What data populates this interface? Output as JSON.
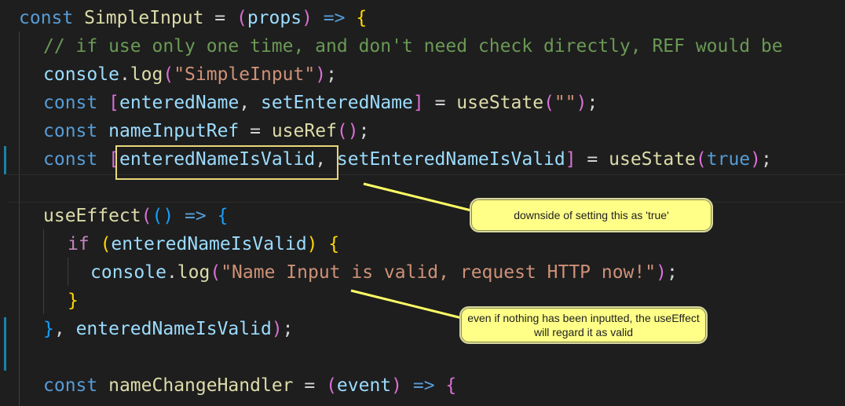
{
  "editor": {
    "theme_colors": {
      "background": "#1e1e1e",
      "keyword": "#569cd6",
      "function": "#dcdcaa",
      "variable": "#9cdcfe",
      "string": "#ce9178",
      "comment": "#6a9955",
      "bracket_level1": "#ffd700",
      "bracket_level2": "#da70d6",
      "bracket_level3": "#179fff",
      "gutter_change_marker": "#1b81a8",
      "annotation_box": "#e8d77c",
      "callout_fill": "#ffff88"
    },
    "lines": {
      "l1": {
        "kw": "const",
        "name": "SimpleInput",
        "eq": " = ",
        "paren_open": "(",
        "param": "props",
        "paren_close": ")",
        "arrow": " => ",
        "brace": "{"
      },
      "l2": {
        "comment": "// if use only one time, and don't need check directly, REF would be"
      },
      "l3": {
        "obj": "console",
        "dot": ".",
        "method": "log",
        "paren_open": "(",
        "string": "\"SimpleInput\"",
        "paren_close": ")",
        "semi": ";"
      },
      "l4": {
        "kw": "const",
        "bracket_open": "[",
        "name1": "enteredName",
        "comma": ", ",
        "name2": "setEnteredName",
        "bracket_close": "]",
        "eq": " = ",
        "fn": "useState",
        "paren_open": "(",
        "string": "\"\"",
        "paren_close": ")",
        "semi": ";"
      },
      "l5": {
        "kw": "const",
        "name": "nameInputRef",
        "eq": " = ",
        "fn": "useRef",
        "parens": "()",
        "semi": ";"
      },
      "l6": {
        "kw": "const",
        "bracket_open": "[",
        "name1": "enteredNameIsValid",
        "comma": ", ",
        "name2": "setEnteredNameIsValid",
        "bracket_close": "]",
        "eq": " = ",
        "fn": "useState",
        "paren_open": "(",
        "value": "true",
        "paren_close": ")",
        "semi": ";"
      },
      "l8": {
        "fn": "useEffect",
        "paren_open": "(",
        "inner_parens": "()",
        "arrow": " => ",
        "brace": "{"
      },
      "l9": {
        "kw": "if",
        "paren_open": "(",
        "var": "enteredNameIsValid",
        "paren_close": ")",
        "brace": "{"
      },
      "l10": {
        "obj": "console",
        "dot": ".",
        "method": "log",
        "paren_open": "(",
        "string": "\"Name Input is valid, request HTTP now!\"",
        "paren_close": ")",
        "semi": ";"
      },
      "l11": {
        "brace": "}"
      },
      "l12": {
        "brace": "}",
        "comma": ", ",
        "var": "enteredNameIsValid",
        "paren_close": ")",
        "semi": ";"
      },
      "l14": {
        "kw": "const",
        "name": "nameChangeHandler",
        "eq": " = ",
        "paren_open": "(",
        "param": "event",
        "paren_close": ")",
        "arrow": " => ",
        "brace": "{"
      }
    }
  },
  "annotations": {
    "callout1": "downside of setting this as 'true'",
    "callout2": "even if nothing has been inputted, the useEffect will regard it as valid"
  }
}
